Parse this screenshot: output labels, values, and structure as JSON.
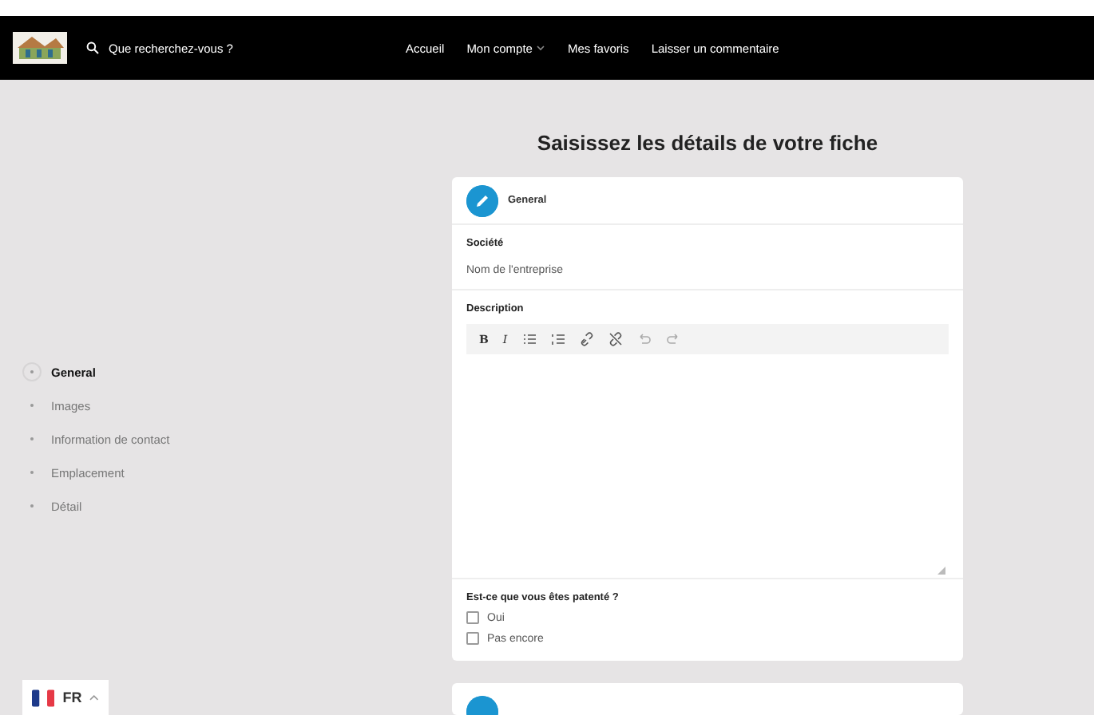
{
  "header": {
    "search_placeholder": "Que recherchez-vous ?",
    "nav": [
      {
        "label": "Accueil",
        "dropdown": false
      },
      {
        "label": "Mon compte",
        "dropdown": true
      },
      {
        "label": "Mes favoris",
        "dropdown": false
      },
      {
        "label": "Laisser un commentaire",
        "dropdown": false
      }
    ]
  },
  "sidebar": {
    "items": [
      {
        "label": "General",
        "selected": true
      },
      {
        "label": "Images",
        "selected": false
      },
      {
        "label": "Information de contact",
        "selected": false
      },
      {
        "label": "Emplacement",
        "selected": false
      },
      {
        "label": "Détail",
        "selected": false
      }
    ]
  },
  "page_title": "Saisissez les détails de votre fiche",
  "card": {
    "title": "General",
    "company": {
      "label": "Société",
      "placeholder": "Nom de l'entreprise"
    },
    "description": {
      "label": "Description",
      "toolbar": [
        {
          "kind": "bold",
          "label": "B"
        },
        {
          "kind": "italic",
          "label": "I"
        },
        {
          "kind": "bullets"
        },
        {
          "kind": "numbers"
        },
        {
          "kind": "link"
        },
        {
          "kind": "unlink"
        },
        {
          "kind": "undo"
        },
        {
          "kind": "redo"
        }
      ]
    },
    "question": {
      "label": "Est-ce que vous êtes patenté ?",
      "options": [
        {
          "label": "Oui",
          "checked": false
        },
        {
          "label": "Pas encore",
          "checked": false
        }
      ]
    }
  },
  "language": {
    "code": "FR"
  }
}
